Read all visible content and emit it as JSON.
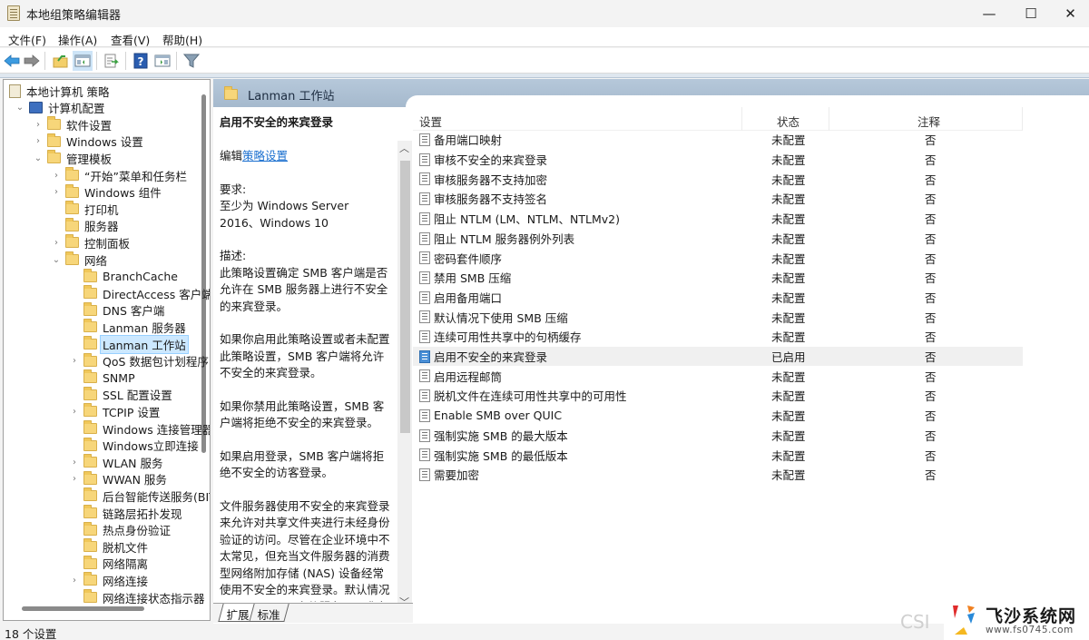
{
  "window": {
    "title": "本地组策略编辑器",
    "controls": {
      "minimize": "—",
      "maximize": "☐",
      "close": "✕"
    }
  },
  "menu": [
    "文件(F)",
    "操作(A)",
    "查看(V)",
    "帮助(H)"
  ],
  "toolbar": [
    {
      "icon": "back-arrow-icon"
    },
    {
      "icon": "forward-arrow-icon"
    },
    {
      "icon": "up-folder-icon"
    },
    {
      "icon": "show-hide-tree-icon",
      "active": true
    },
    {
      "icon": "export-list-icon"
    },
    {
      "icon": "help-icon"
    },
    {
      "icon": "properties-pane-icon"
    },
    {
      "icon": "filter-icon"
    }
  ],
  "tree": {
    "items": [
      {
        "label": "本地计算机 策略",
        "level": 0,
        "icon": "policy-doc-icon",
        "chevron": ""
      },
      {
        "label": "计算机配置",
        "level": 1,
        "icon": "computer-icon",
        "chevron": "v"
      },
      {
        "label": "软件设置",
        "level": 2,
        "icon": "folder",
        "chevron": ">"
      },
      {
        "label": "Windows 设置",
        "level": 2,
        "icon": "folder",
        "chevron": ">"
      },
      {
        "label": "管理模板",
        "level": 2,
        "icon": "folder",
        "chevron": "v"
      },
      {
        "label": "“开始”菜单和任务栏",
        "level": 3,
        "icon": "folder",
        "chevron": ">"
      },
      {
        "label": "Windows 组件",
        "level": 3,
        "icon": "folder",
        "chevron": ">"
      },
      {
        "label": "打印机",
        "level": 3,
        "icon": "folder",
        "chevron": ""
      },
      {
        "label": "服务器",
        "level": 3,
        "icon": "folder",
        "chevron": ""
      },
      {
        "label": "控制面板",
        "level": 3,
        "icon": "folder",
        "chevron": ">"
      },
      {
        "label": "网络",
        "level": 3,
        "icon": "folder",
        "chevron": "v"
      },
      {
        "label": "BranchCache",
        "level": 4,
        "icon": "folder",
        "chevron": ""
      },
      {
        "label": "DirectAccess 客户端",
        "level": 4,
        "icon": "folder",
        "chevron": ""
      },
      {
        "label": "DNS 客户端",
        "level": 4,
        "icon": "folder",
        "chevron": ""
      },
      {
        "label": "Lanman 服务器",
        "level": 4,
        "icon": "folder",
        "chevron": ""
      },
      {
        "label": "Lanman 工作站",
        "level": 4,
        "icon": "folder",
        "chevron": "",
        "selected": true
      },
      {
        "label": "QoS 数据包计划程序",
        "level": 4,
        "icon": "folder",
        "chevron": ">"
      },
      {
        "label": "SNMP",
        "level": 4,
        "icon": "folder",
        "chevron": ""
      },
      {
        "label": "SSL 配置设置",
        "level": 4,
        "icon": "folder",
        "chevron": ""
      },
      {
        "label": "TCPIP 设置",
        "level": 4,
        "icon": "folder",
        "chevron": ">"
      },
      {
        "label": "Windows 连接管理器",
        "level": 4,
        "icon": "folder",
        "chevron": ""
      },
      {
        "label": "Windows立即连接",
        "level": 4,
        "icon": "folder",
        "chevron": ""
      },
      {
        "label": "WLAN 服务",
        "level": 4,
        "icon": "folder",
        "chevron": ">"
      },
      {
        "label": "WWAN 服务",
        "level": 4,
        "icon": "folder",
        "chevron": ">"
      },
      {
        "label": "后台智能传送服务(BITS)",
        "level": 4,
        "icon": "folder",
        "chevron": ""
      },
      {
        "label": "链路层拓扑发现",
        "level": 4,
        "icon": "folder",
        "chevron": ""
      },
      {
        "label": "热点身份验证",
        "level": 4,
        "icon": "folder",
        "chevron": ""
      },
      {
        "label": "脱机文件",
        "level": 4,
        "icon": "folder",
        "chevron": ""
      },
      {
        "label": "网络隔离",
        "level": 4,
        "icon": "folder",
        "chevron": ""
      },
      {
        "label": "网络连接",
        "level": 4,
        "icon": "folder",
        "chevron": ">"
      },
      {
        "label": "网络连接状态指示器",
        "level": 4,
        "icon": "folder",
        "chevron": ""
      }
    ]
  },
  "pane_header": {
    "title": "Lanman 工作站"
  },
  "description": {
    "title": "启用不安全的来宾登录",
    "edit_prefix": "编辑",
    "edit_link": "策略设置",
    "requirements_label": "要求:",
    "requirements": "至少为 Windows Server 2016、Windows 10",
    "description_label": "描述:",
    "paragraphs": [
      "此策略设置确定 SMB 客户端是否允许在 SMB 服务器上进行不安全的来宾登录。",
      "如果你启用此策略设置或者未配置此策略设置，SMB 客户端将允许不安全的来宾登录。",
      "如果你禁用此策略设置，SMB 客户端将拒绝不安全的来宾登录。",
      "如果启用登录，SMB 客户端将拒绝不安全的访客登录。",
      "文件服务器使用不安全的来宾登录来允许对共享文件夹进行未经身份验证的访问。尽管在企业环境中不太常见，但充当文件服务器的消费型网络附加存储 (NAS) 设备经常使用不安全的来宾登录。默认情况下，Windows 文件服务器要求身份验证并且不会使用不安全的来宾"
    ]
  },
  "tabs": [
    "扩展",
    "标准"
  ],
  "list": {
    "columns": [
      "设置",
      "状态",
      "注释"
    ],
    "rows": [
      {
        "name": "备用端口映射",
        "state": "未配置",
        "comment": "否"
      },
      {
        "name": "审核不安全的来宾登录",
        "state": "未配置",
        "comment": "否"
      },
      {
        "name": "审核服务器不支持加密",
        "state": "未配置",
        "comment": "否"
      },
      {
        "name": "审核服务器不支持签名",
        "state": "未配置",
        "comment": "否"
      },
      {
        "name": "阻止 NTLM (LM、NTLM、NTLMv2)",
        "state": "未配置",
        "comment": "否"
      },
      {
        "name": "阻止 NTLM 服务器例外列表",
        "state": "未配置",
        "comment": "否"
      },
      {
        "name": "密码套件顺序",
        "state": "未配置",
        "comment": "否"
      },
      {
        "name": "禁用 SMB 压缩",
        "state": "未配置",
        "comment": "否"
      },
      {
        "name": "启用备用端口",
        "state": "未配置",
        "comment": "否"
      },
      {
        "name": "默认情况下使用 SMB 压缩",
        "state": "未配置",
        "comment": "否"
      },
      {
        "name": "连续可用性共享中的句柄缓存",
        "state": "未配置",
        "comment": "否"
      },
      {
        "name": "启用不安全的来宾登录",
        "state": "已启用",
        "comment": "否",
        "selected": true
      },
      {
        "name": "启用远程邮筒",
        "state": "未配置",
        "comment": "否"
      },
      {
        "name": "脱机文件在连续可用性共享中的可用性",
        "state": "未配置",
        "comment": "否"
      },
      {
        "name": "Enable SMB over QUIC",
        "state": "未配置",
        "comment": "否"
      },
      {
        "name": "强制实施 SMB 的最大版本",
        "state": "未配置",
        "comment": "否"
      },
      {
        "name": "强制实施 SMB 的最低版本",
        "state": "未配置",
        "comment": "否"
      },
      {
        "name": "需要加密",
        "state": "未配置",
        "comment": "否"
      }
    ]
  },
  "status": {
    "text": "18 个设置"
  },
  "watermark": {
    "brand": "飞沙系统网",
    "url": "www.fs0745.com",
    "csd": "CSI"
  },
  "colors": {
    "selection": "#cce8ff",
    "link": "#1a6fcf",
    "header": "#a7bbd0"
  }
}
